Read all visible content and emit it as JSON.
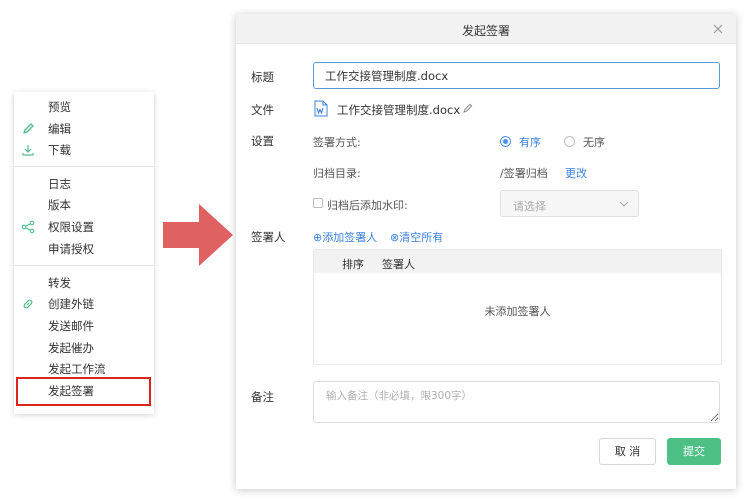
{
  "menu": {
    "items": [
      {
        "label": "预览",
        "icon": ""
      },
      {
        "label": "编辑",
        "icon": "pencil-icon"
      },
      {
        "label": "下载",
        "icon": "download-icon"
      },
      {
        "label": "日志",
        "icon": ""
      },
      {
        "label": "版本",
        "icon": ""
      },
      {
        "label": "权限设置",
        "icon": "share-icon"
      },
      {
        "label": "申请授权",
        "icon": ""
      },
      {
        "label": "转发",
        "icon": ""
      },
      {
        "label": "创建外链",
        "icon": "link-icon"
      },
      {
        "label": "发送邮件",
        "icon": ""
      },
      {
        "label": "发起催办",
        "icon": ""
      },
      {
        "label": "发起工作流",
        "icon": ""
      },
      {
        "label": "发起签署",
        "icon": ""
      }
    ],
    "highlighted": "发起签署",
    "icon_color": "#4fbd8a",
    "highlight_color": "#d9251d"
  },
  "arrow": {
    "icon": "right-arrow-icon",
    "color": "#e06161"
  },
  "dialog": {
    "title": "发起签署",
    "close_icon": "close-icon",
    "title_label": "标题",
    "title_value": "工作交接管理制度.docx",
    "file_label": "文件",
    "file_name": "工作交接管理制度.docx",
    "file_icon": "word-doc-icon",
    "settings_label": "设置",
    "sign_mode_label": "签署方式:",
    "sign_mode_options": [
      "有序",
      "无序"
    ],
    "sign_mode_selected": "有序",
    "archive_label": "归档目录:",
    "archive_path": "/签署归档",
    "archive_change": "更改",
    "watermark_label": "归档后添加水印:",
    "watermark_checked": false,
    "watermark_select_placeholder": "请选择",
    "signers_label": "签署人",
    "add_signer": "⊕添加签署人",
    "clear_all": "⊗清空所有",
    "table_headers": [
      "排序",
      "签署人"
    ],
    "empty_text": "未添加签署人",
    "remark_label": "备注",
    "remark_placeholder": "输入备注（非必填，限300字）",
    "cancel_label": "取 消",
    "submit_label": "提交",
    "accent_color": "#3c84e0",
    "submit_color": "#4fc085"
  }
}
